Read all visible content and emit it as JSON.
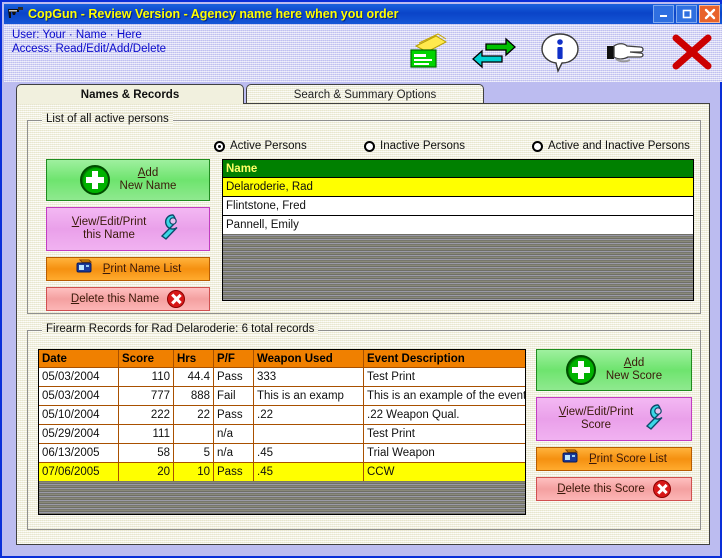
{
  "window": {
    "title": "CopGun - Review Version - Agency name here when you order",
    "icon": "gun-icon",
    "minimize_label": "_",
    "maximize_label": "□",
    "close_label": "✕",
    "titlebar_bg": "#0a44c8",
    "title_color": "#ffff00"
  },
  "header": {
    "user_line": "User: Your · Name · Here",
    "access_line": "Access: Read/Edit/Add/Delete",
    "text_color": "#0a0acc",
    "tools": [
      {
        "name": "print-report-icon",
        "title": "Reports"
      },
      {
        "name": "switch-arrows-icon",
        "title": "Switch"
      },
      {
        "name": "info-icon",
        "title": "Information"
      },
      {
        "name": "pointing-hand-icon",
        "title": "Help"
      },
      {
        "name": "exit-x-icon",
        "title": "Exit"
      }
    ]
  },
  "tabs": [
    {
      "label": "Names & Records",
      "active": true
    },
    {
      "label": "Search & Summary Options",
      "active": false
    }
  ],
  "persons_group": {
    "legend": "List of all active persons",
    "filters": [
      {
        "label": "Active Persons",
        "selected": true
      },
      {
        "label": "Inactive Persons",
        "selected": false
      },
      {
        "label": "Active and Inactive Persons",
        "selected": false
      }
    ],
    "buttons": [
      {
        "name": "add-new-name-button",
        "line1": "Add",
        "line2": "New Name",
        "accel": "A",
        "icon": "plus-circle-icon",
        "style": "green"
      },
      {
        "name": "view-edit-print-name-button",
        "line1": "View/Edit/Print",
        "line2": "this Name",
        "accel": "V",
        "icon": "wrench-icon",
        "style": "pink"
      },
      {
        "name": "print-name-list-button",
        "label": "Print Name List",
        "accel": "P",
        "icon": "printer-icon",
        "style": "orange"
      },
      {
        "name": "delete-name-button",
        "label": "Delete this Name",
        "accel": "D",
        "icon": "x-circle-icon",
        "style": "red"
      }
    ],
    "grid": {
      "header_bg": "#008000",
      "header_color": "#ffff66",
      "columns": [
        "Name"
      ],
      "rows": [
        {
          "cells": [
            "Delaroderie, Rad"
          ],
          "selected": true
        },
        {
          "cells": [
            "Flintstone, Fred"
          ],
          "selected": false
        },
        {
          "cells": [
            "Pannell, Emily"
          ],
          "selected": false
        }
      ]
    }
  },
  "records_group": {
    "legend": "Firearm Records for Rad Delaroderie: 6 total records",
    "buttons": [
      {
        "name": "add-new-score-button",
        "line1": "Add",
        "line2": "New Score",
        "accel": "A",
        "icon": "plus-circle-icon",
        "style": "green"
      },
      {
        "name": "view-edit-print-score-button",
        "line1": "View/Edit/Print",
        "line2": "Score",
        "accel": "V",
        "icon": "wrench-icon",
        "style": "pink"
      },
      {
        "name": "print-score-list-button",
        "label": "Print Score List",
        "accel": "P",
        "icon": "printer-icon",
        "style": "orange"
      },
      {
        "name": "delete-score-button",
        "label": "Delete this Score",
        "accel": "D",
        "icon": "x-circle-icon",
        "style": "red"
      }
    ],
    "grid": {
      "header_bg": "#f08000",
      "columns": [
        "Date",
        "Score",
        "Hrs",
        "P/F",
        "Weapon Used",
        "Event Description"
      ],
      "rows": [
        {
          "cells": [
            "05/03/2004",
            "110",
            "44.4",
            "Pass",
            "333",
            "Test Print"
          ],
          "selected": false
        },
        {
          "cells": [
            "05/03/2004",
            "777",
            "888",
            "Fail",
            "This is an examp",
            "This is an example of the event des"
          ],
          "selected": false
        },
        {
          "cells": [
            "05/10/2004",
            "222",
            "22",
            "Pass",
            ".22",
            ".22 Weapon Qual."
          ],
          "selected": false
        },
        {
          "cells": [
            "05/29/2004",
            "111",
            "",
            "n/a",
            "",
            "Test Print"
          ],
          "selected": false
        },
        {
          "cells": [
            "06/13/2005",
            "58",
            "5",
            "n/a",
            ".45",
            "Trial Weapon"
          ],
          "selected": false
        },
        {
          "cells": [
            "07/06/2005",
            "20",
            "10",
            "Pass",
            ".45",
            "CCW"
          ],
          "selected": true
        }
      ]
    }
  }
}
